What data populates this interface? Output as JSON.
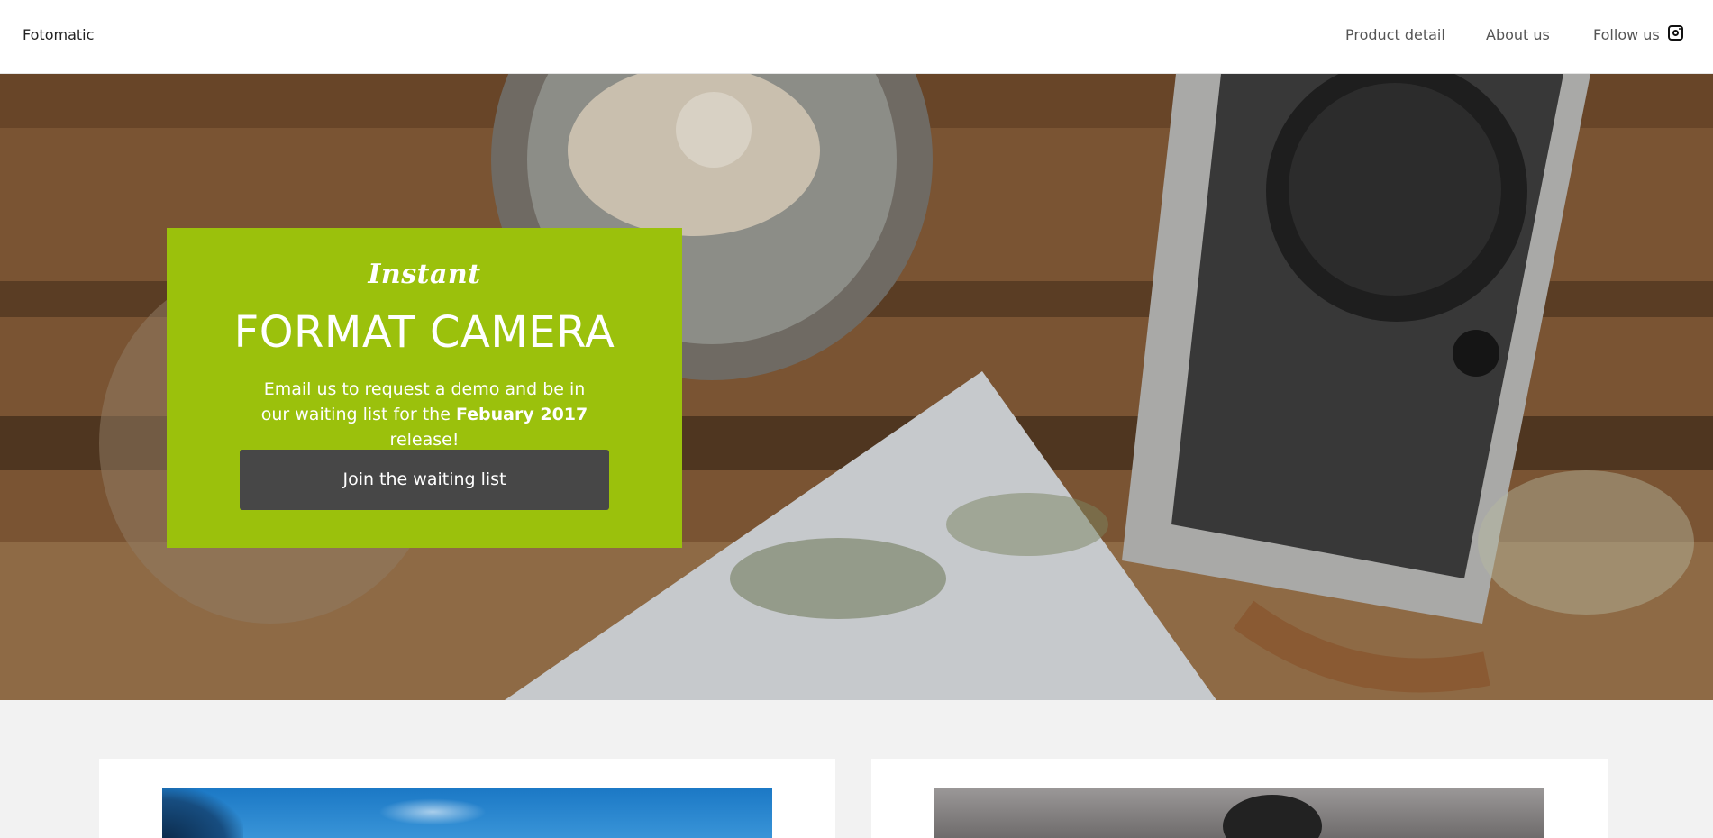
{
  "header": {
    "brand": "Fotomatic",
    "nav": [
      {
        "label": "Product detail"
      },
      {
        "label": "About us"
      },
      {
        "label": "Follow us"
      }
    ],
    "social_icon": "instagram-icon"
  },
  "hero": {
    "script_title": "Instant",
    "title": "FORMAT CAMERA",
    "text_before": "Email us to request a demo and be in our waiting list for the ",
    "text_bold": "Febuary 2017",
    "text_after": " release!",
    "button_label": "Join the waiting list",
    "card_color": "#9bc10c",
    "button_color": "#474747"
  },
  "cards": [
    {
      "image": "sky-photo"
    },
    {
      "image": "camera-photo"
    }
  ]
}
